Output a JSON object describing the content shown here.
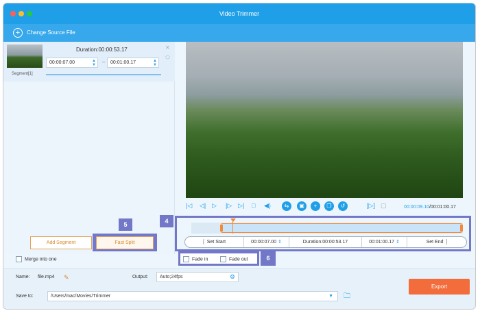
{
  "window": {
    "title": "Video Trimmer"
  },
  "toolbar": {
    "change_source_label": "Change Source File"
  },
  "segment": {
    "label": "Segment[1]",
    "duration": "Duration:00:00:53.17",
    "start_time": "00:00:07.00",
    "end_time": "00:01:00.17"
  },
  "left_actions": {
    "add_segment_label": "Add Segment",
    "fast_split_label": "Fast Split",
    "merge_label": "Merge into one"
  },
  "markers": {
    "m4": "4",
    "m5": "5",
    "m6": "6"
  },
  "player": {
    "current_time": "00:00:09.10",
    "total_time": "/00:01:00.17"
  },
  "timeline": {
    "set_start_label": "Set Start",
    "start_value": "00:00:07.00",
    "duration_value": "Duration:00:00:53.17",
    "end_value": "00:01:00.17",
    "set_end_label": "Set End"
  },
  "fade": {
    "fade_in_label": "Fade in",
    "fade_out_label": "Fade out"
  },
  "output": {
    "name_label": "Name:",
    "name_value": "file.mp4",
    "output_label": "Output:",
    "output_value": "Auto;24fps",
    "save_label": "Save to:",
    "save_path": "/Users/mac/Movies/Trimmer",
    "export_label": "Export"
  },
  "colors": {
    "accent": "#1f9fe8",
    "marker": "#7278c7",
    "export": "#f26c3c"
  }
}
